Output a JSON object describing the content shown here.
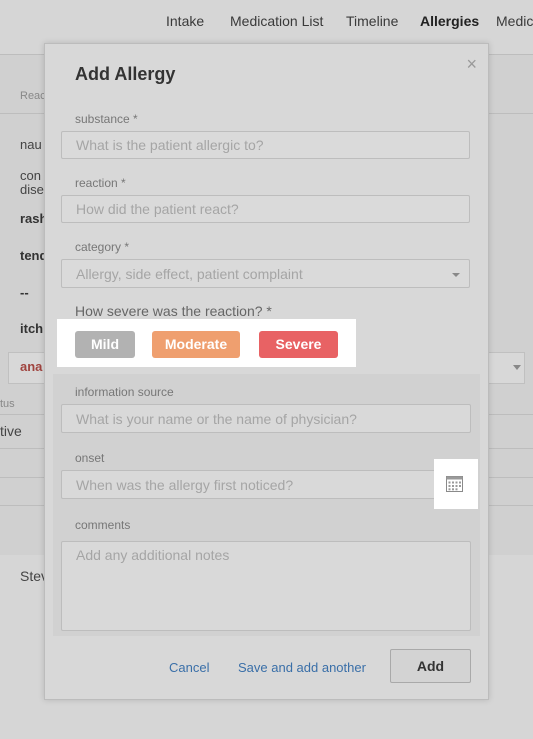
{
  "nav": {
    "tabs": [
      "Intake",
      "Medication List",
      "Timeline",
      "Allergies",
      "Medic"
    ],
    "active": "Allergies"
  },
  "background": {
    "left_texts": [
      "Reac",
      "nau",
      "con",
      "dise",
      "rash",
      "tend",
      "--",
      "itch",
      "ana",
      "tus",
      "tive",
      "Stev"
    ]
  },
  "modal": {
    "title": "Add Allergy",
    "close_glyph": "×",
    "substance": {
      "label": "substance *",
      "placeholder": "What is the patient allergic to?"
    },
    "reaction": {
      "label": "reaction *",
      "placeholder": "How did the patient react?"
    },
    "category": {
      "label": "category *",
      "placeholder": "Allergy, side effect, patient complaint"
    },
    "severity": {
      "question": "How severe was the reaction? *",
      "buttons": [
        {
          "label": "Mild",
          "color": "#b2b2b2"
        },
        {
          "label": "Moderate",
          "color": "#ef9f6f"
        },
        {
          "label": "Severe",
          "color": "#e86264"
        }
      ]
    },
    "information_source": {
      "label": "information source",
      "placeholder": "What is your name or the name of physician?"
    },
    "onset": {
      "label": "onset",
      "placeholder": "When was the allergy first noticed?"
    },
    "comments": {
      "label": "comments",
      "placeholder": "Add any additional notes"
    },
    "footer": {
      "cancel": "Cancel",
      "save_and_add": "Save and add another",
      "add": "Add"
    }
  },
  "colors": {
    "link": "#3a6fa8",
    "overlay": "#d8d8d8"
  }
}
